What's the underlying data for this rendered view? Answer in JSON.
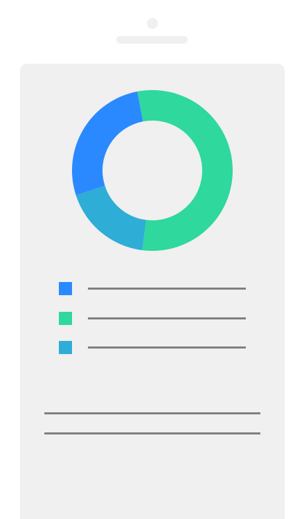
{
  "colors": {
    "background": "#ffffff",
    "device": "#f0f0f0",
    "text_line": "#808080",
    "blue": "#2b89ff",
    "green": "#2fd89d",
    "cyan": "#2eadd6"
  },
  "icons": {
    "camera": "camera-icon",
    "speaker": "speaker-icon"
  },
  "chart_data": {
    "type": "pie",
    "title": "",
    "series": [
      {
        "values": [
          27,
          55,
          18
        ]
      }
    ],
    "slices": [
      {
        "value": 27,
        "color": "#2b89ff"
      },
      {
        "value": 55,
        "color": "#2fd89d"
      },
      {
        "value": 18,
        "color": "#2eadd6"
      }
    ],
    "legend": {
      "placement": "bottom"
    }
  }
}
